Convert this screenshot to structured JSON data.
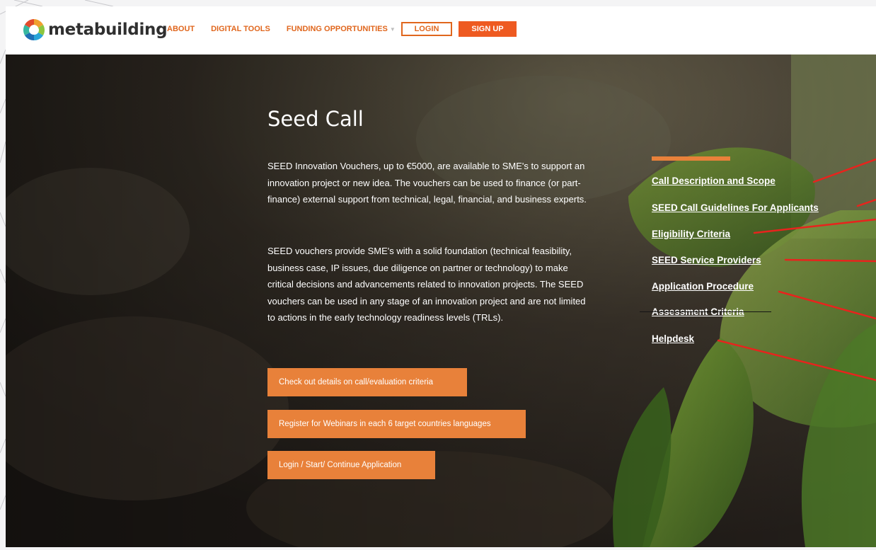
{
  "brand": {
    "name": "metabuilding",
    "accent_color": "#e0661d",
    "signup_color": "#ee5a21",
    "button_color": "#e8813a",
    "logo_icon": "multicolor-ring-logo-icon"
  },
  "nav": {
    "about": "ABOUT",
    "digital_tools": "DIGITAL TOOLS",
    "funding": "FUNDING OPPORTUNITIES",
    "funding_caret": "▼",
    "login": "LOGIN",
    "signup": "SIGN UP"
  },
  "hero": {
    "title": "Seed Call",
    "paragraph1": "SEED Innovation Vouchers, up to €5000, are available to SME's to support an innovation project or new idea. The vouchers can be used to finance (or part-finance) external support from technical, legal, financial, and business experts.",
    "paragraph2": "SEED vouchers provide SME's with a solid foundation (technical feasibility, business case, IP issues, due diligence on partner or technology) to make critical decisions and advancements related to innovation projects. The SEED vouchers can be used in any stage of an innovation project and are not limited to actions in the early technology readiness levels (TRLs).",
    "buttons": [
      "Check out details on call/evaluation criteria",
      "Register for Webinars in each 6 target countries languages",
      "Login / Start/ Continue Application"
    ]
  },
  "side_links": [
    "Call Description and Scope",
    "SEED Call Guidelines For Applicants",
    "Eligibility Criteria",
    "SEED Service Providers",
    "Application Procedure",
    "Assessment Criteria",
    "Helpdesk"
  ]
}
